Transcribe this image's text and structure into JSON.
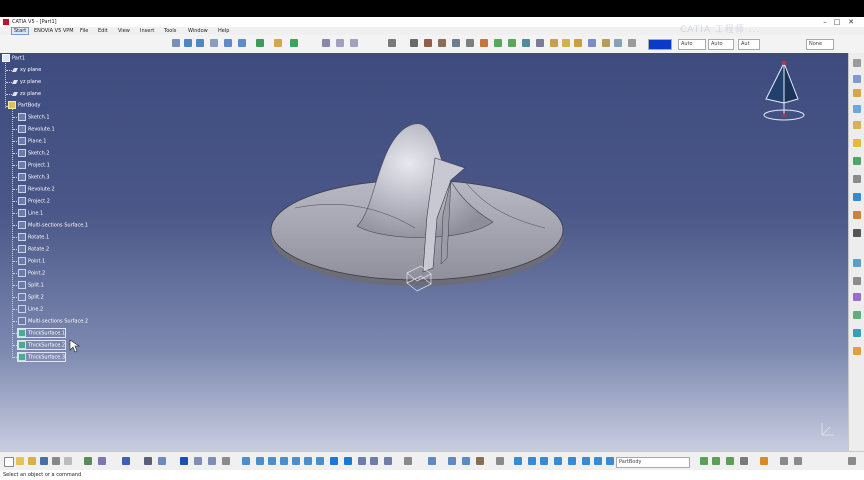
{
  "window": {
    "title": "CATIA V5 - [Part1]",
    "buttons": {
      "minimize": "–",
      "maximize": "□",
      "close": "✕"
    }
  },
  "menu": {
    "items": [
      "Start",
      "ENOVIA V5 VPM",
      "File",
      "Edit",
      "View",
      "Insert",
      "Tools",
      "Window",
      "Help"
    ]
  },
  "watermark": "CATIA 工程师 ...",
  "toolbar": {
    "color_combo": "",
    "combo_auto_1": "Auto",
    "combo_auto_2": "Auto",
    "combo_auto_3": "Aut",
    "combo_none": "None"
  },
  "tree": {
    "root": "Part1",
    "items": [
      {
        "label": "xy plane",
        "kind": "plane"
      },
      {
        "label": "yz plane",
        "kind": "plane"
      },
      {
        "label": "zx plane",
        "kind": "plane"
      },
      {
        "label": "PartBody",
        "kind": "body"
      },
      {
        "label": "Sketch.1",
        "kind": "feature"
      },
      {
        "label": "Revolute.1",
        "kind": "feature"
      },
      {
        "label": "Plane.1",
        "kind": "feature"
      },
      {
        "label": "Sketch.2",
        "kind": "feature"
      },
      {
        "label": "Project.1",
        "kind": "feature"
      },
      {
        "label": "Sketch.3",
        "kind": "feature"
      },
      {
        "label": "Revolute.2",
        "kind": "feature"
      },
      {
        "label": "Project.2",
        "kind": "feature"
      },
      {
        "label": "Line.1",
        "kind": "feature"
      },
      {
        "label": "Multi-sections Surface.1",
        "kind": "feature"
      },
      {
        "label": "Rotate.1",
        "kind": "feature"
      },
      {
        "label": "Rotate.2",
        "kind": "feature"
      },
      {
        "label": "Point.1",
        "kind": "feature"
      },
      {
        "label": "Point.2",
        "kind": "feature"
      },
      {
        "label": "Split.1",
        "kind": "feature"
      },
      {
        "label": "Split.2",
        "kind": "feature"
      },
      {
        "label": "Line.2",
        "kind": "feature"
      },
      {
        "label": "Multi-sections Surface.2",
        "kind": "feature"
      },
      {
        "label": "ThickSurface.1",
        "kind": "thick"
      },
      {
        "label": "ThickSurface.2",
        "kind": "thick"
      },
      {
        "label": "ThickSurface.3",
        "kind": "thick"
      }
    ]
  },
  "bottom_toolbar": {
    "body_combo": "PartBody"
  },
  "status": {
    "message": "Select an object or a command"
  }
}
